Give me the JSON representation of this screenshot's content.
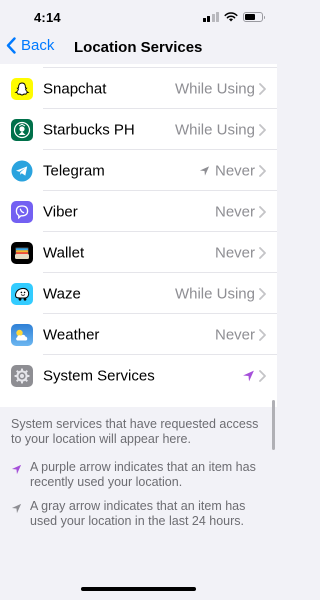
{
  "status_bar": {
    "time": "4:14",
    "signal": "signal-bars-icon",
    "wifi": "wifi-icon",
    "battery": "battery-icon",
    "battery_level": 0.62
  },
  "nav": {
    "back_label": "Back",
    "title": "Location Services"
  },
  "apps": [
    {
      "name": "Snapchat",
      "status": "While Using",
      "icon": "snapchat-icon",
      "arrow": null
    },
    {
      "name": "Starbucks PH",
      "status": "While Using",
      "icon": "starbucks-icon",
      "arrow": null
    },
    {
      "name": "Telegram",
      "status": "Never",
      "icon": "telegram-icon",
      "arrow": "gray"
    },
    {
      "name": "Viber",
      "status": "Never",
      "icon": "viber-icon",
      "arrow": null
    },
    {
      "name": "Wallet",
      "status": "Never",
      "icon": "wallet-icon",
      "arrow": null
    },
    {
      "name": "Waze",
      "status": "While Using",
      "icon": "waze-icon",
      "arrow": null
    },
    {
      "name": "Weather",
      "status": "Never",
      "icon": "weather-icon",
      "arrow": null
    },
    {
      "name": "System Services",
      "status": "",
      "icon": "gear-icon",
      "arrow": "purple"
    }
  ],
  "footer": {
    "system_services_note": "System services that have requested access to your location will appear here.",
    "purple_legend": "A purple arrow indicates that an item has recently used your location.",
    "gray_legend": "A gray arrow indicates that an item has used your location in the last 24 hours."
  },
  "colors": {
    "accent": "#007aff",
    "purple_arrow": "#a550d9",
    "gray_arrow": "#8e8e93"
  }
}
